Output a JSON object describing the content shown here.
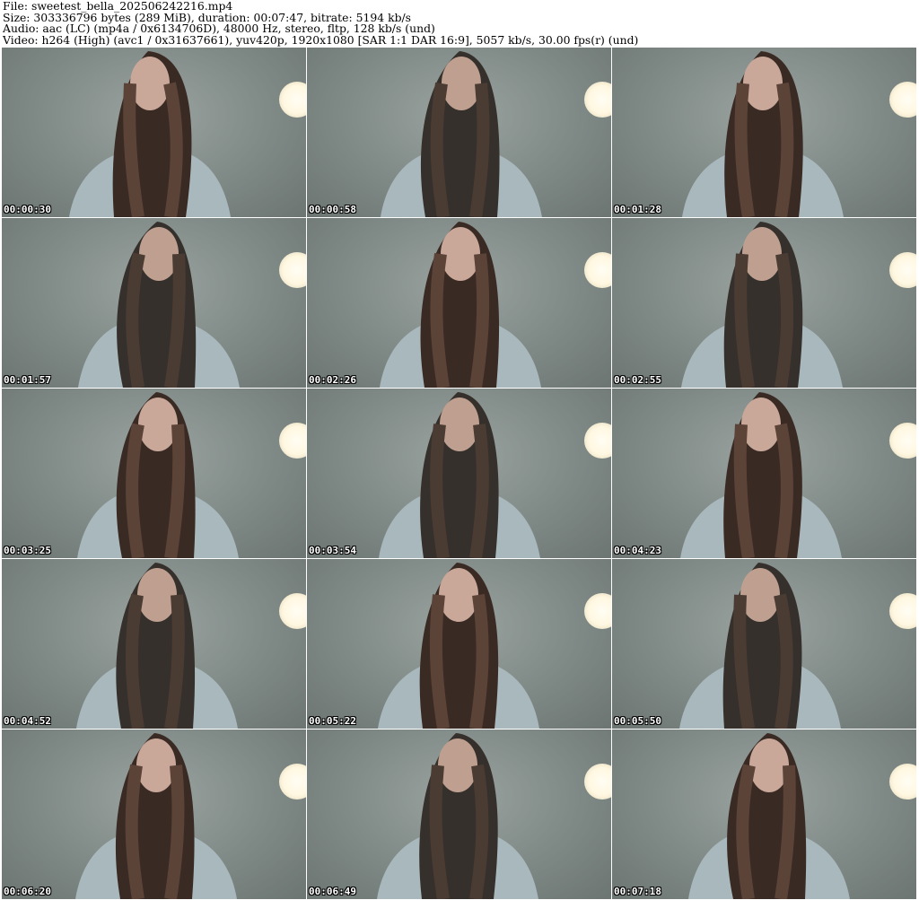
{
  "header": {
    "file_line": "File: sweetest_bella_202506242216.mp4",
    "size_line": "Size: 303336796 bytes (289 MiB), duration: 00:07:47, bitrate: 5194 kb/s",
    "audio_line": "Audio: aac (LC) (mp4a / 0x6134706D), 48000 Hz, stereo, fltp, 128 kb/s (und)",
    "video_line": "Video: h264 (High) (avc1 / 0x31637661), yuv420p, 1920x1080 [SAR 1:1 DAR 16:9], 5057 kb/s, 30.00 fps(r) (und)"
  },
  "thumbnails": [
    {
      "timestamp": "00:00:30"
    },
    {
      "timestamp": "00:00:58"
    },
    {
      "timestamp": "00:01:28"
    },
    {
      "timestamp": "00:01:57"
    },
    {
      "timestamp": "00:02:26"
    },
    {
      "timestamp": "00:02:55"
    },
    {
      "timestamp": "00:03:25"
    },
    {
      "timestamp": "00:03:54"
    },
    {
      "timestamp": "00:04:23"
    },
    {
      "timestamp": "00:04:52"
    },
    {
      "timestamp": "00:05:22"
    },
    {
      "timestamp": "00:05:50"
    },
    {
      "timestamp": "00:06:20"
    },
    {
      "timestamp": "00:06:49"
    },
    {
      "timestamp": "00:07:18"
    }
  ],
  "colors": {
    "background": "#ffffff",
    "header_text": "#000000",
    "timestamp_text": "#ffffff"
  }
}
